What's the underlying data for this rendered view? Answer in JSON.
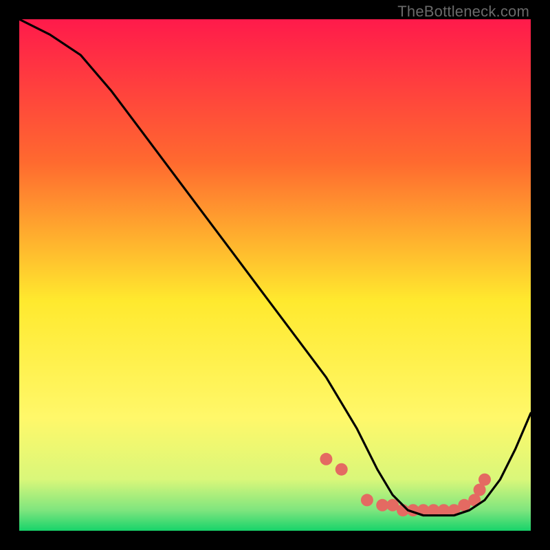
{
  "watermark": "TheBottleneck.com",
  "chart_data": {
    "type": "line",
    "title": "",
    "xlabel": "",
    "ylabel": "",
    "xlim": [
      0,
      100
    ],
    "ylim": [
      0,
      100
    ],
    "grid": false,
    "background_gradient": {
      "top": "#ff1a4b",
      "mid_upper": "#ff8a2a",
      "mid": "#ffe92e",
      "mid_lower": "#f7ff6e",
      "band": "#b8f58a",
      "bottom": "#17d36a"
    },
    "series": [
      {
        "name": "bottleneck-curve",
        "x": [
          0,
          6,
          12,
          18,
          24,
          30,
          36,
          42,
          48,
          54,
          60,
          66,
          70,
          73,
          76,
          79,
          82,
          85,
          88,
          91,
          94,
          97,
          100
        ],
        "y": [
          100,
          97,
          93,
          86,
          78,
          70,
          62,
          54,
          46,
          38,
          30,
          20,
          12,
          7,
          4,
          3,
          3,
          3,
          4,
          6,
          10,
          16,
          23
        ]
      }
    ],
    "markers": {
      "name": "dot-cluster",
      "x": [
        60,
        63,
        68,
        71,
        73,
        75,
        77,
        79,
        81,
        83,
        85,
        87,
        89,
        90,
        91
      ],
      "y": [
        14,
        12,
        6,
        5,
        5,
        4,
        4,
        4,
        4,
        4,
        4,
        5,
        6,
        8,
        10
      ],
      "color": "#e46a62",
      "r": 9
    }
  }
}
